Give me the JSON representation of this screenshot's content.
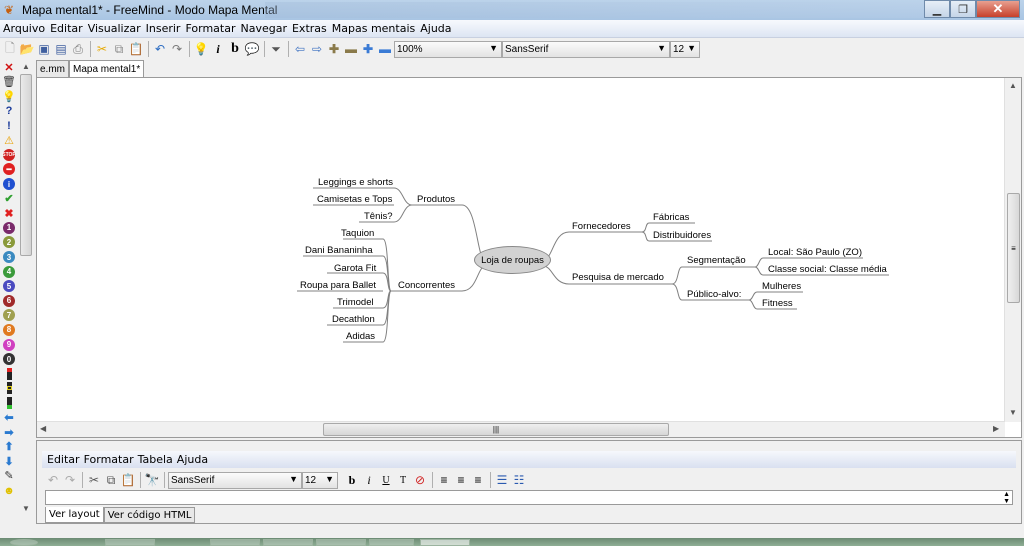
{
  "window": {
    "title": "Mapa mental1* - FreeMind - Modo Mapa Mental",
    "app_icon": "freemind-butterfly-icon",
    "controls": [
      "minimize",
      "maximize",
      "close"
    ]
  },
  "menubar": {
    "items": [
      "Arquivo",
      "Editar",
      "Visualizar",
      "Inserir",
      "Formatar",
      "Navegar",
      "Extras",
      "Mapas mentais",
      "Ajuda"
    ]
  },
  "toolbar": {
    "icons": [
      "new-icon",
      "open-icon",
      "save-icon",
      "save-as-icon",
      "print-icon",
      "cut-icon",
      "copy-icon",
      "paste-icon",
      "undo-icon",
      "redo-icon",
      "idea-bulb-icon",
      "italic-icon",
      "bold-icon",
      "cloud-icon",
      "filter-icon",
      "back-icon",
      "forward-icon",
      "zoom-in-icon",
      "zoom-out-icon",
      "expand-icon",
      "collapse-icon"
    ],
    "zoom_value": "100%",
    "font_value": "SansSerif",
    "size_value": "12"
  },
  "left_icons": [
    "remove-icon-x",
    "trash-icon",
    "bulb-icon",
    "question-icon",
    "exclamation-icon",
    "warning-icon",
    "stop-icon",
    "no-entry-icon",
    "info-icon",
    "check-icon",
    "cross-icon",
    "priority-1-icon",
    "priority-2-icon",
    "priority-3-icon",
    "priority-4-icon",
    "priority-5-icon",
    "priority-6-icon",
    "priority-7-icon",
    "priority-8-icon",
    "priority-9-icon",
    "priority-0-icon",
    "traffic-light-red-icon",
    "traffic-light-yellow-icon",
    "traffic-light-green-icon",
    "arrow-left-icon",
    "arrow-right-icon",
    "arrow-up-icon",
    "arrow-down-icon",
    "pencil-icon",
    "smiley-icon"
  ],
  "doc_tabs": [
    {
      "label": "e.mm",
      "active": false
    },
    {
      "label": "Mapa mental1*",
      "active": true
    }
  ],
  "mindmap": {
    "root": "Loja de roupas",
    "left": [
      {
        "label": "Produtos",
        "children": [
          "Leggings e shorts",
          "Camisetas e Tops",
          "Tênis?"
        ]
      },
      {
        "label": "Concorrentes",
        "children": [
          "Taquion",
          "Dani Bananinha",
          "Garota Fit",
          "Roupa para Ballet",
          "Trimodel",
          "Decathlon",
          "Adidas"
        ]
      }
    ],
    "right": [
      {
        "label": "Fornecedores",
        "children": [
          "Fábricas",
          "Distribuidores"
        ]
      },
      {
        "label": "Pesquisa de mercado",
        "children": [
          {
            "label": "Segmentação",
            "children": [
              "Local: São Paulo (ZO)",
              "Classe social: Classe média"
            ]
          },
          {
            "label": "Público-alvo:",
            "children": [
              "Mulheres",
              "Fitness"
            ]
          }
        ]
      }
    ]
  },
  "notes": {
    "menu": [
      "Editar",
      "Formatar",
      "Tabela",
      "Ajuda"
    ],
    "font_value": "SansSerif",
    "size_value": "12",
    "input_value": "",
    "view_tabs": [
      {
        "label": "Ver layout",
        "active": true
      },
      {
        "label": "Ver código HTML",
        "active": false
      }
    ]
  },
  "colors": {
    "root_fill": "#d2d2d2",
    "edge": "#808080",
    "menubar": "#dde5f3",
    "close_button": "#c7402b"
  }
}
